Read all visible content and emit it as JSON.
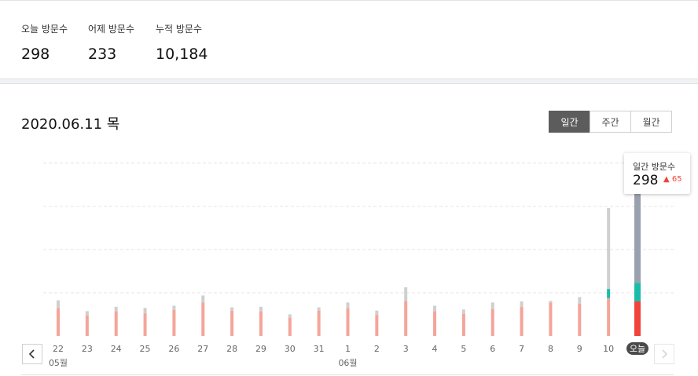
{
  "summary": {
    "today_label": "오늘 방문수",
    "today_value": "298",
    "yesterday_label": "어제 방문수",
    "yesterday_value": "233",
    "total_label": "누적 방문수",
    "total_value": "10,184"
  },
  "date_title": "2020.06.11 목",
  "period_tabs": [
    "일간",
    "주간",
    "월간"
  ],
  "tooltip": {
    "label": "일간 방문수",
    "value": "298",
    "diff": "65"
  },
  "colors": {
    "pink": "#f4a59a",
    "gray": "#cfcfcf",
    "teal": "#19bca8",
    "red": "#f0443a",
    "slate": "#98a1ad",
    "active_tab": "#5c5c5c"
  },
  "chart_data": {
    "type": "bar",
    "categories": [
      "22",
      "23",
      "24",
      "25",
      "26",
      "27",
      "28",
      "29",
      "30",
      "31",
      "1",
      "2",
      "3",
      "4",
      "5",
      "6",
      "7",
      "8",
      "9",
      "10",
      "오늘"
    ],
    "month_labels": [
      {
        "at": "22",
        "text": "05월"
      },
      {
        "at": "1",
        "text": "06월"
      }
    ],
    "series": [
      {
        "values": [
          52,
          38,
          46,
          42,
          48,
          62,
          47,
          46,
          34,
          47,
          52,
          39,
          65,
          46,
          41,
          50,
          54,
          62,
          60,
          70,
          64
        ]
      },
      {
        "values": [
          0,
          0,
          0,
          0,
          0,
          0,
          0,
          0,
          0,
          0,
          0,
          0,
          0,
          0,
          0,
          0,
          0,
          0,
          0,
          17,
          34
        ]
      },
      {
        "values": [
          14,
          8,
          8,
          10,
          8,
          13,
          6,
          8,
          6,
          6,
          10,
          8,
          25,
          10,
          8,
          12,
          10,
          3,
          12,
          150,
          200
        ]
      }
    ],
    "ylim": [
      0,
      340
    ],
    "highlight": "오늘",
    "grid": true
  }
}
